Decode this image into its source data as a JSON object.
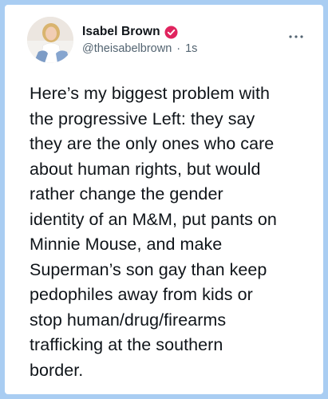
{
  "tweet": {
    "author": {
      "name": "Isabel Brown",
      "handle": "@theisabelbrown",
      "verified_icon": "verified-badge-icon",
      "verified_color": "#e0245e"
    },
    "separator": "·",
    "timestamp": "1s",
    "more_icon": "more-options-icon",
    "text": "Here’s my biggest problem with\nthe progressive Left: they say\nthey are the only ones who care\nabout human rights, but would\nrather change the gender\nidentity of an M&M, put pants on\nMinnie Mouse, and make\nSuperman’s son gay than keep\npedophiles away from kids or\nstop human/drug/firearms\ntrafficking at the southern\nborder."
  },
  "colors": {
    "frame_border": "#a9cdf2",
    "text_primary": "#0f1419",
    "text_secondary": "#536471"
  }
}
